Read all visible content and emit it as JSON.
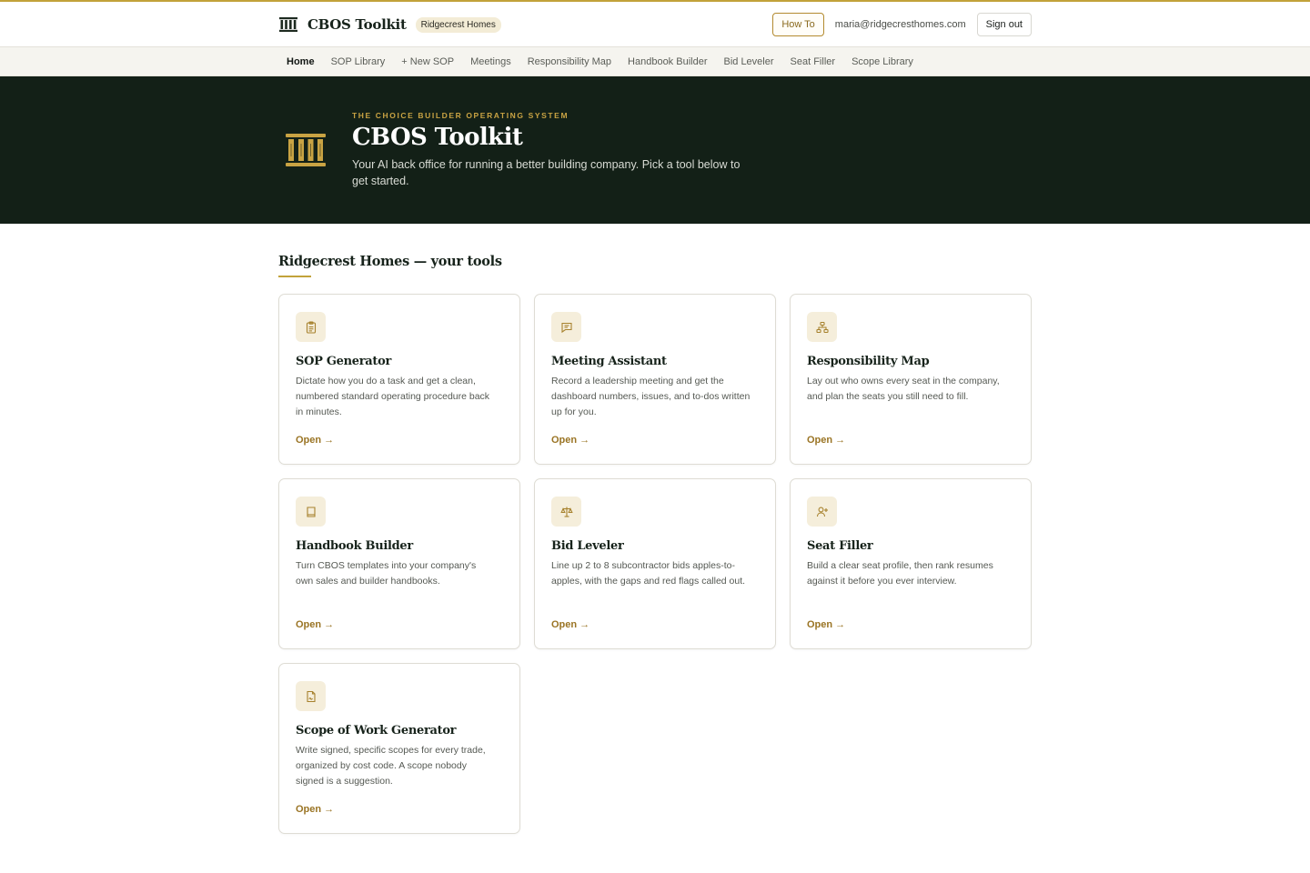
{
  "header": {
    "brand_name": "CBOS Toolkit",
    "org_badge": "Ridgecrest Homes",
    "howto_label": "How To",
    "user_email": "maria@ridgecresthomes.com",
    "signout_label": "Sign out"
  },
  "nav": {
    "items": [
      {
        "label": "Home"
      },
      {
        "label": "SOP Library"
      },
      {
        "label": "+ New SOP"
      },
      {
        "label": "Meetings"
      },
      {
        "label": "Responsibility Map"
      },
      {
        "label": "Handbook Builder"
      },
      {
        "label": "Bid Leveler"
      },
      {
        "label": "Seat Filler"
      },
      {
        "label": "Scope Library"
      }
    ],
    "active": "Home"
  },
  "hero": {
    "eyebrow": "THE CHOICE BUILDER OPERATING SYSTEM",
    "title": "CBOS Toolkit",
    "subtitle": "Your AI back office for running a better building company. Pick a tool below to get started."
  },
  "section": {
    "title": "Ridgecrest Homes — your tools"
  },
  "cards": [
    {
      "icon": "clipboard-icon",
      "title": "SOP Generator",
      "description": "Dictate how you do a task and get a clean, numbered standard operating procedure back in minutes.",
      "action": "Open →"
    },
    {
      "icon": "message-square-icon",
      "title": "Meeting Assistant",
      "description": "Record a leadership meeting and get the dashboard numbers, issues, and to-dos written up for you.",
      "action": "Open →"
    },
    {
      "icon": "org-chart-icon",
      "title": "Responsibility Map",
      "description": "Lay out who owns every seat in the company, and plan the seats you still need to fill.",
      "action": "Open →"
    },
    {
      "icon": "book-icon",
      "title": "Handbook Builder",
      "description": "Turn CBOS templates into your company's own sales and builder handbooks.",
      "action": "Open →"
    },
    {
      "icon": "scale-icon",
      "title": "Bid Leveler",
      "description": "Line up 2 to 8 subcontractor bids apples-to-apples, with the gaps and red flags called out.",
      "action": "Open →"
    },
    {
      "icon": "user-plus-icon",
      "title": "Seat Filler",
      "description": "Build a clear seat profile, then rank resumes against it before you ever interview.",
      "action": "Open →"
    },
    {
      "icon": "file-signature-icon",
      "title": "Scope of Work Generator",
      "description": "Write signed, specific scopes for every trade, organized by cost code. A scope nobody signed is a suggestion.",
      "action": "Open →"
    }
  ],
  "colors": {
    "accent_gold": "#c2a23a",
    "hero_bg": "#132017",
    "link_gold": "#9a7424"
  }
}
